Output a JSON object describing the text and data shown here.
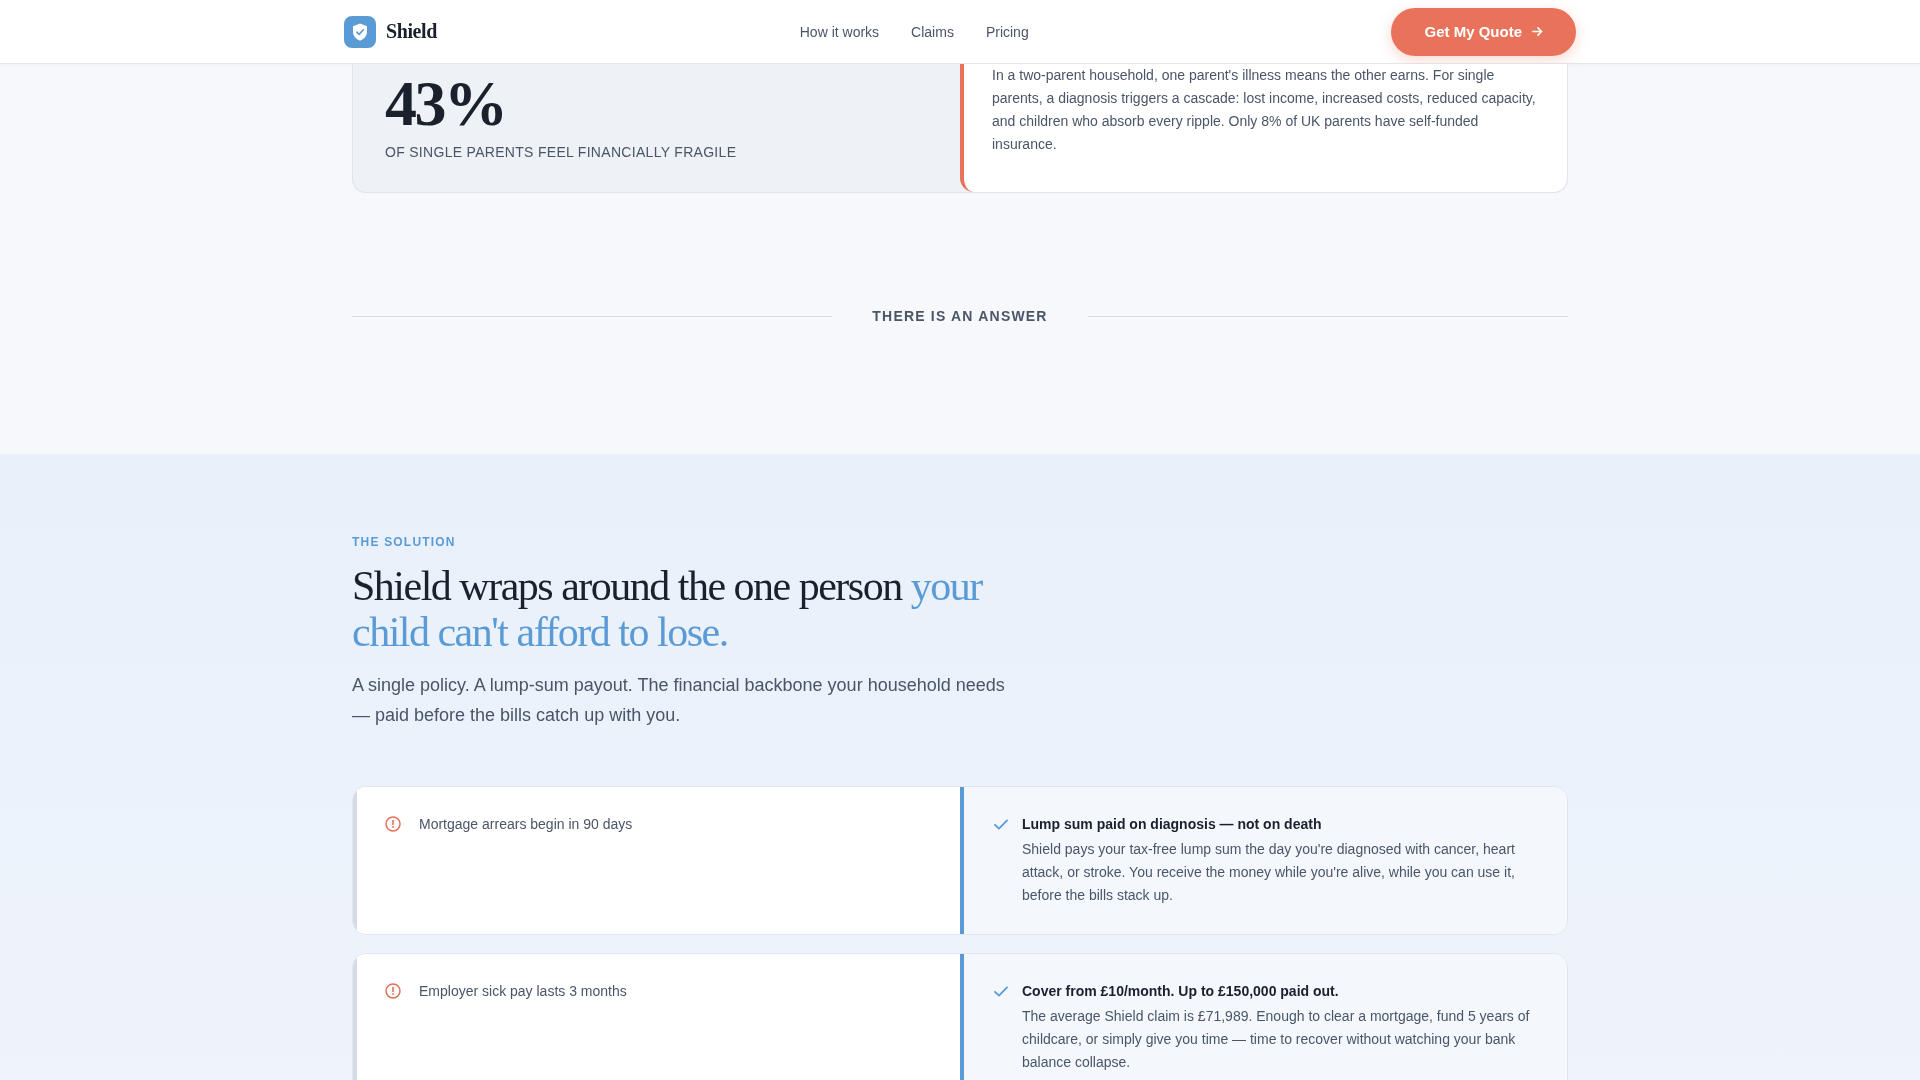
{
  "header": {
    "brand": "Shield",
    "nav": [
      "How it works",
      "Claims",
      "Pricing"
    ],
    "cta": "Get My Quote"
  },
  "stat_card": {
    "value": "43%",
    "caption": "OF SINGLE PARENTS FEEL FINANCIALLY FRAGILE",
    "body": "In a two-parent household, one parent's illness means the other earns. For single parents, a diagnosis triggers a cascade: lost income, increased costs, reduced capacity, and children who absorb every ripple. Only 8% of UK parents have self-funded insurance."
  },
  "divider": {
    "label": "THERE IS AN ANSWER"
  },
  "solution": {
    "eyebrow": "THE SOLUTION",
    "heading": "Shield wraps around the one person",
    "heading_highlight": "your child can't afford to lose.",
    "lead": "A single policy. A lump-sum payout. The financial backbone your household needs — paid before the bills catch up with you.",
    "rows": [
      {
        "problem": "Mortgage arrears begin in 90 days",
        "benefit_title": "Lump sum paid on diagnosis — not on death",
        "benefit_text": "Shield pays your tax-free lump sum the day you're diagnosed with cancer, heart attack, or stroke. You receive the money while you're alive, while you can use it, before the bills stack up."
      },
      {
        "problem": "Employer sick pay lasts 3 months",
        "benefit_title": "Cover from £10/month. Up to £150,000 paid out.",
        "benefit_text": "The average Shield claim is £71,989. Enough to clear a mortgage, fund 5 years of childcare, or simply give you time — time to recover without watching your bank balance collapse."
      }
    ]
  }
}
